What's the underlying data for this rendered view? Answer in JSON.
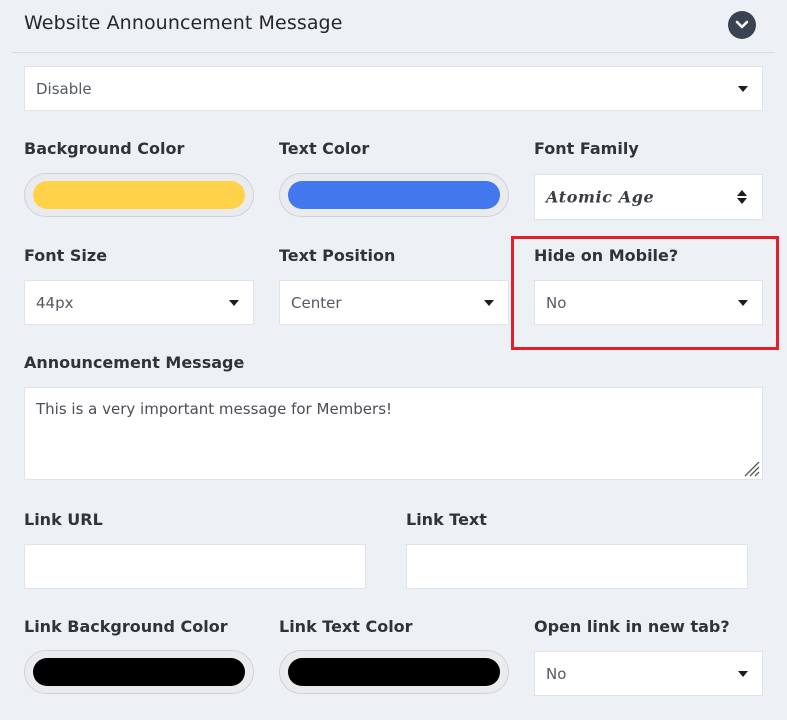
{
  "header": {
    "title": "Website Announcement Message"
  },
  "announcement_status": {
    "value": "Disable"
  },
  "fields": {
    "background_color": {
      "label": "Background Color",
      "color": "#ffd24a"
    },
    "text_color": {
      "label": "Text Color",
      "color": "#4277ee"
    },
    "font_family": {
      "label": "Font Family",
      "value": "Atomic Age"
    },
    "font_size": {
      "label": "Font Size",
      "value": "44px"
    },
    "text_position": {
      "label": "Text Position",
      "value": "Center"
    },
    "hide_on_mobile": {
      "label": "Hide on Mobile?",
      "value": "No"
    },
    "announcement_message": {
      "label": "Announcement Message",
      "value": "This is a very important message for Members!"
    },
    "link_url": {
      "label": "Link URL",
      "value": ""
    },
    "link_text": {
      "label": "Link Text",
      "value": ""
    },
    "link_background_color": {
      "label": "Link Background Color",
      "color": "#000000"
    },
    "link_text_color": {
      "label": "Link Text Color",
      "color": "#000000"
    },
    "open_new_tab": {
      "label": "Open link in new tab?",
      "value": "No"
    }
  },
  "colors": {
    "highlight": "#e3202a",
    "header_toggle": "#3a4352"
  },
  "icons": {
    "header_toggle": "chevron-down-icon",
    "select_arrow": "caret-down-icon",
    "font_select_arrow": "up-down-arrows-icon",
    "textarea_resize": "resize-handle-icon"
  }
}
